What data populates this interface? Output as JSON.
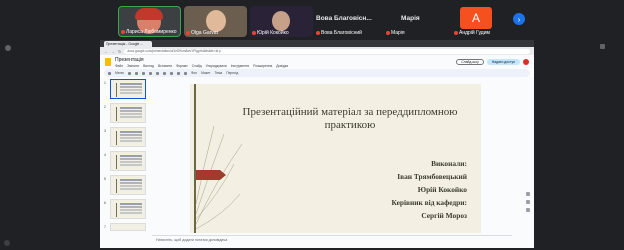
{
  "participants": [
    {
      "name": "Лариса Любомиренко",
      "photo": "person-photo"
    },
    {
      "name": "Olga Garvat",
      "photo": "person-photo"
    },
    {
      "name": "Юрій Кокойко",
      "photo": "person-photo"
    }
  ],
  "name_tiles": [
    {
      "title": "Вова Благовісн...",
      "label": "Вова Благовісний"
    },
    {
      "title": "Марія",
      "label": "Марія"
    }
  ],
  "avatar_tile": {
    "letter": "А",
    "label": "Андрій Гудим"
  },
  "colors": {
    "accent": "#1a73e8",
    "avatar": "#f4511e",
    "mic_off": "#ea4335",
    "slide_bg": "#f3f0e3",
    "slide_arrow": "#a33a2e"
  },
  "browser": {
    "tab_label": "Презентація - Google ...",
    "url": "docs.google.com/presentation/d/1eD9nm8wvYPlgy/edit#slide=id.p"
  },
  "slides_app": {
    "doc_title": "Презентація",
    "menu": [
      "Файл",
      "Змінити",
      "Вигляд",
      "Вставити",
      "Формат",
      "Слайд",
      "Упорядкувати",
      "Інструменти",
      "Розширення",
      "Довідка"
    ],
    "slideshow_label": "Слайд-шоу",
    "share_label": "Надати доступ",
    "toolbar": [
      "Меню",
      "Фон",
      "Макет",
      "Тема",
      "Перехід"
    ],
    "notes_placeholder": "Натисніть, щоб додати нотатки доповідача"
  },
  "thumbnails": [
    1,
    2,
    3,
    4,
    5,
    6,
    7
  ],
  "slide": {
    "title": "Презентаційний матеріал за переддипломною практикою",
    "credits": [
      "Виконали:",
      "Іван Трямбовецький",
      "Юрій Кокойко",
      "Керівник від кафедри:",
      "Сергій Мороз"
    ]
  }
}
